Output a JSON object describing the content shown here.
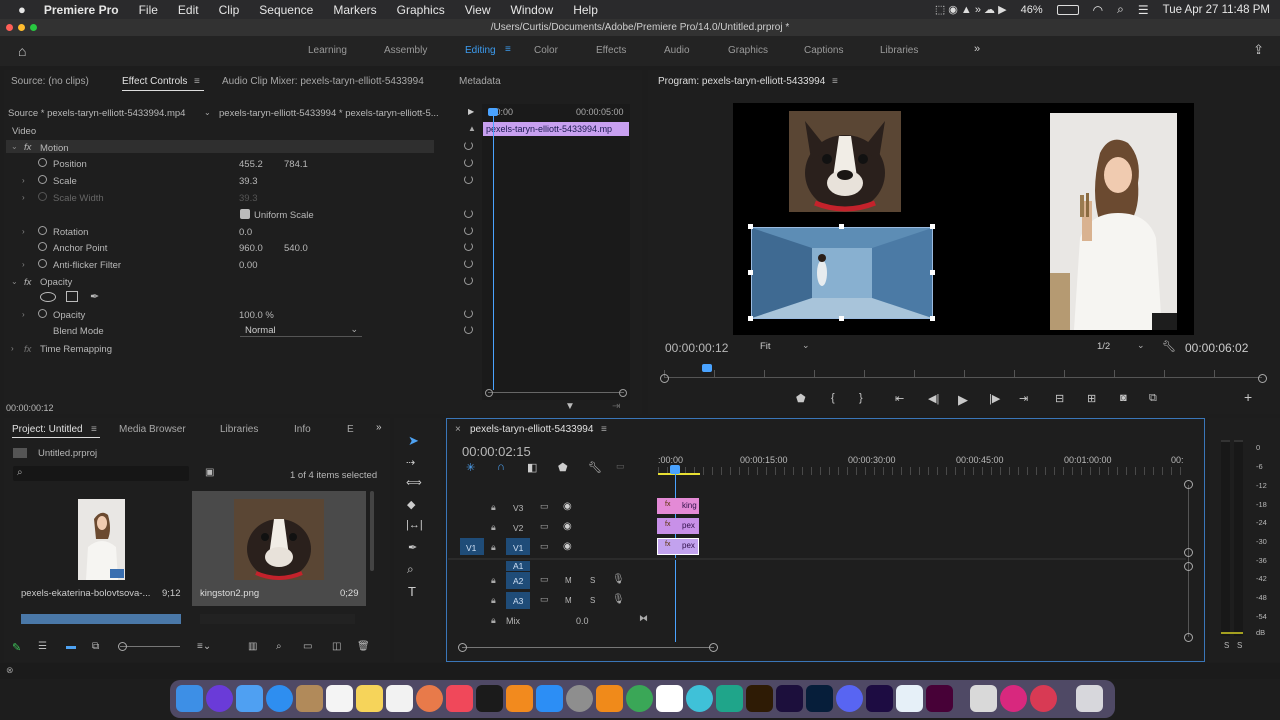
{
  "menubar": {
    "app": "Premiere Pro",
    "items": [
      "File",
      "Edit",
      "Clip",
      "Sequence",
      "Markers",
      "Graphics",
      "View",
      "Window",
      "Help"
    ],
    "battery": "46%",
    "datetime": "Tue Apr 27  11:48 PM"
  },
  "window": {
    "title": "/Users/Curtis/Documents/Adobe/Premiere Pro/14.0/Untitled.prproj *"
  },
  "workspaces": [
    "Learning",
    "Assembly",
    "Editing",
    "Color",
    "Effects",
    "Audio",
    "Graphics",
    "Captions",
    "Libraries"
  ],
  "effect_panel": {
    "tabs": {
      "source": "Source: (no clips)",
      "effect_controls": "Effect Controls",
      "mixer": "Audio Clip Mixer: pexels-taryn-elliott-5433994",
      "metadata": "Metadata"
    },
    "source_label": "Source * pexels-taryn-elliott-5433994.mp4",
    "sequence_label": "pexels-taryn-elliott-5433994 * pexels-taryn-elliott-5...",
    "ruler_start": ":00:00",
    "ruler_end": "00:00:05:00",
    "clip_label": "pexels-taryn-elliott-5433994.mp",
    "video_label": "Video",
    "motion": "Motion",
    "position": {
      "label": "Position",
      "x": "455.2",
      "y": "784.1"
    },
    "scale": {
      "label": "Scale",
      "value": "39.3"
    },
    "scale_width": {
      "label": "Scale Width",
      "value": "39.3"
    },
    "uniform_scale": "Uniform Scale",
    "rotation": {
      "label": "Rotation",
      "value": "0.0"
    },
    "anchor": {
      "label": "Anchor Point",
      "x": "960.0",
      "y": "540.0"
    },
    "antiflicker": {
      "label": "Anti-flicker Filter",
      "value": "0.00"
    },
    "opacity_group": "Opacity",
    "opacity": {
      "label": "Opacity",
      "value": "100.0 %"
    },
    "blend": {
      "label": "Blend Mode",
      "value": "Normal"
    },
    "time_remap": "Time Remapping",
    "timecode": "00:00:00:12"
  },
  "program": {
    "title": "Program: pexels-taryn-elliott-5433994",
    "timecode": "00:00:00:12",
    "fit": "Fit",
    "quality": "1/2",
    "duration": "00:00:06:02"
  },
  "project": {
    "tabs": {
      "project": "Project: Untitled",
      "media_browser": "Media Browser",
      "libraries": "Libraries",
      "info": "Info",
      "more": "E"
    },
    "file": "Untitled.prproj",
    "selected_count": "1 of 4 items selected",
    "items": [
      {
        "name": "pexels-ekaterina-bolovtsova-...",
        "duration": "9;12"
      },
      {
        "name": "kingston2.png",
        "duration": "0;29"
      }
    ]
  },
  "timeline": {
    "tab": "pexels-taryn-elliott-5433994",
    "timecode": "00:00:02:15",
    "ruler": [
      ":00:00",
      "00:00:15:00",
      "00:00:30:00",
      "00:00:45:00",
      "00:01:00:00",
      "00:"
    ],
    "tracks": {
      "v3": "V3",
      "v2": "V2",
      "v1": "V1",
      "v1src": "V1",
      "a1": "A1",
      "a2": "A2",
      "a3": "A3",
      "mix": "Mix",
      "mix_value": "0.0"
    },
    "clips": {
      "v3": "king",
      "v2": "pex",
      "v1": "pex"
    },
    "mute": "M",
    "solo": "S"
  },
  "meter": {
    "scale": [
      "0",
      "-6",
      "-12",
      "-18",
      "-24",
      "-30",
      "-36",
      "-42",
      "-48",
      "-54",
      "dB"
    ],
    "solo": [
      "S",
      "S"
    ]
  }
}
